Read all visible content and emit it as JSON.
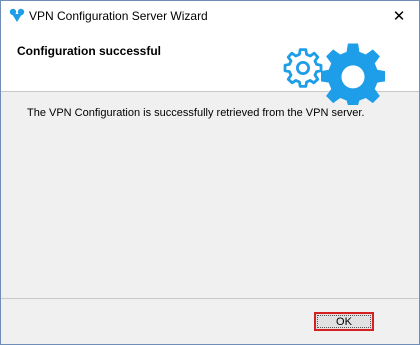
{
  "window": {
    "title": "VPN Configuration Server Wizard",
    "close_glyph": "✕"
  },
  "header": {
    "title": "Configuration successful",
    "icons": [
      "gear-icon",
      "gear-icon"
    ]
  },
  "main": {
    "message": "The VPN Configuration is successfully retrieved from the VPN server."
  },
  "footer": {
    "ok_label": "OK"
  },
  "colors": {
    "accent": "#1e9ee8",
    "highlight_border": "#d42020"
  }
}
